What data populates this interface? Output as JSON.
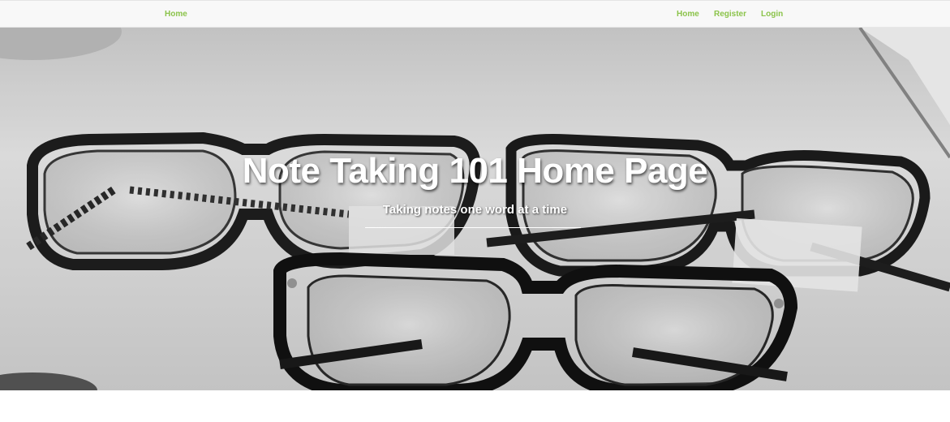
{
  "navbar": {
    "brand_label": "Home",
    "links": [
      {
        "label": "Home"
      },
      {
        "label": "Register"
      },
      {
        "label": "Login"
      }
    ],
    "link_color": "#8bc34a"
  },
  "hero": {
    "title": "Note Taking 101 Home Page",
    "subtitle": "Taking notes one word at a time",
    "background_image": "grayscale-photo-of-eyeglasses"
  }
}
